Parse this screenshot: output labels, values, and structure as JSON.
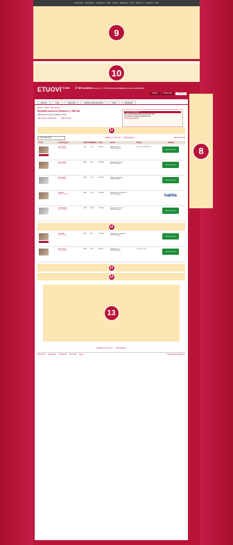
{
  "topbar": [
    "Asuntoautot",
    "Kaupunkien",
    "Vuokrasivut",
    "Mökit",
    "Myynti",
    "Mökkianjat",
    "Tontit",
    "Rakennus",
    "Lomakodit",
    "Muut"
  ],
  "ads": {
    "top": "9",
    "mid": "10",
    "side": "8",
    "list": "11",
    "inline": "12",
    "bottom": "13"
  },
  "header": {
    "logo": "ETUOVI",
    "logo_suffix": "°COM",
    "tagline_bold": "37 060 kohdetta",
    "tagline_rest": "Suomen 1 779 kiinteistönvälittäjältä ja rakennusliikkeiltä",
    "user": [
      "Kirjaudu",
      "Rekisteröidy",
      "Oma sivu"
    ]
  },
  "tabs": [
    "Etusivu",
    "Haku",
    "Hakuvahti",
    "Etsitkö vuokra-asuntoa?",
    "Vinkit",
    "Muistilista"
  ],
  "breadcrumb": "Etusivu > Haku > Hae kohteet",
  "heading": "Myytävät asunnot (Tampere) 1 836 kpl",
  "meta": "Hakuehdot: Asunnot, Luokittelu: Vanhat",
  "links": [
    "Hakuehtojen muuttaminen",
    "Tallenna haku"
  ],
  "infobox": {
    "title": "Etuovi.com palvelut",
    "lines": [
      "Voit muuttaa hakuehtojasi tai tallentaa haun",
      "Uusi kohde -ilmoitukset sähköpostiisi"
    ],
    "link": "Tutustu kohdevahtiin"
  },
  "controls": {
    "sort": "Uusimmat ensin",
    "pager": "Edellinen 1 2 3 4 5 6 7 ... 183 Seuraava",
    "sizes": "Näytä 10 20 50"
  },
  "columns": [
    "Kohde",
    "Asuntotyyppi",
    "Rakennusvuosi",
    "Pinta-ala",
    "Hinta",
    "Osoite",
    "Näyttö",
    "Välittäjä"
  ],
  "rows": [
    {
      "title": "Kerrostalo",
      "sub": "1h+k, 32 m²",
      "year": "1972",
      "area": "32,0",
      "price": "99 000",
      "addr1": "Hämeenkatu 12",
      "addr2": "33100 Tampere",
      "show": "Su 14.6. 13:00-14:00",
      "agent": "green",
      "agent_name": "Kiinteistömaailma",
      "thumb": "brown",
      "newtag": true
    },
    {
      "title": "Kerrostalo",
      "sub": "2h+k, 56 m²",
      "year": "1965",
      "area": "56,0",
      "price": "138 000",
      "addr1": "Satakunnankatu 8",
      "addr2": "33210 Tampere",
      "show": "",
      "agent": "green",
      "agent_name": "Kiinteistömaailma",
      "thumb": "brown",
      "newtag": false
    },
    {
      "title": "Kerrostalo",
      "sub": "3h+k, 78 m²",
      "year": "1989",
      "area": "78,0",
      "price": "178 000",
      "addr1": "Kalevan puistotie 4",
      "addr2": "33500 Tampere",
      "show": "",
      "agent": "green",
      "agent_name": "Kiinteistömaailma",
      "thumb": "gray",
      "newtag": false
    },
    {
      "title": "Rivitalo",
      "sub": "4h+k+s, 92 m²",
      "year": "2006",
      "area": "92,0",
      "price": "229 000",
      "addr1": "Hervannan valtaväylä 21",
      "addr2": "33720 Tampere",
      "show": "",
      "agent": "habita",
      "agent_name": "habita",
      "thumb": "brown",
      "newtag": false
    },
    {
      "title": "Omakotitalo",
      "sub": "5h+k, 134 m²",
      "year": "1958",
      "area": "134,0",
      "price": "315 000",
      "addr1": "Kissanmaankatu 3",
      "addr2": "33530 Tampere",
      "show": "",
      "agent": "green",
      "agent_name": "Kiinteistömaailma",
      "thumb": "gray",
      "newtag": false
    },
    {
      "title": "Luhtitalo",
      "sub": "2h+k, 48 m²",
      "year": "1981",
      "area": "48,0",
      "price": "112 000",
      "addr1": "Vuoreksen puistokatu 2",
      "addr2": "33870 Tampere",
      "show": "",
      "agent": "green",
      "agent_name": "Kiinteistömaailma",
      "thumb": "brown",
      "newtag": true
    },
    {
      "title": "Kerrostalo",
      "sub": "1h+kk, 28 m²",
      "year": "1999",
      "area": "28,0",
      "price": "84 500",
      "addr1": "Pyynikintie 15",
      "addr2": "33230 Tampere",
      "show": "Ti 16.6. 17:00",
      "agent": "green",
      "agent_name": "Kiinteistömaailma",
      "thumb": "brown",
      "newtag": false
    }
  ],
  "banner12": "12",
  "bottom_pager": "Edellinen 1 2 3 4 5 6 7 ... 183 Seuraava",
  "footer": {
    "links": [
      "Etuovi.com",
      "Asuntohaku",
      "Mediakortti",
      "Tietosuoja",
      "Ohjeet"
    ],
    "copyright": "© Alma Media Kuluttaja Oy"
  }
}
